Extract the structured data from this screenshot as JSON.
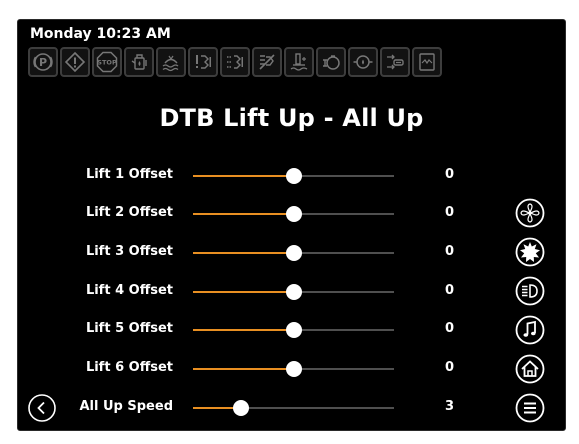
{
  "header": {
    "datetime": "Monday 10:23 AM"
  },
  "status_icons": [
    {
      "name": "parking-brake-icon"
    },
    {
      "name": "warning-icon"
    },
    {
      "name": "stop-icon"
    },
    {
      "name": "fuel-icon"
    },
    {
      "name": "washer-fluid-icon"
    },
    {
      "name": "lift-alert-icon"
    },
    {
      "name": "lift-system-icon"
    },
    {
      "name": "lift-disabled-icon"
    },
    {
      "name": "hydraulic-level-icon"
    },
    {
      "name": "engine-oil-icon"
    },
    {
      "name": "oil-pressure-icon"
    },
    {
      "name": "transmission-icon"
    },
    {
      "name": "panel-icon"
    }
  ],
  "status_icon_labels": {
    "stop": "STOP"
  },
  "page": {
    "title": "DTB Lift Up - All Up"
  },
  "settings": [
    {
      "label": "Lift 1 Offset",
      "value": "0",
      "level": 0.5
    },
    {
      "label": "Lift 2 Offset",
      "value": "0",
      "level": 0.5
    },
    {
      "label": "Lift 3 Offset",
      "value": "0",
      "level": 0.5
    },
    {
      "label": "Lift 4 Offset",
      "value": "0",
      "level": 0.5
    },
    {
      "label": "Lift 5 Offset",
      "value": "0",
      "level": 0.5
    },
    {
      "label": "Lift 6 Offset",
      "value": "0",
      "level": 0.5
    },
    {
      "label": "All Up Speed",
      "value": "3",
      "level": 0.24
    }
  ],
  "side_buttons": [
    {
      "name": "fan-button",
      "icon": "fan-icon"
    },
    {
      "name": "brightness-button",
      "icon": "sun-icon"
    },
    {
      "name": "headlight-button",
      "icon": "headlight-icon"
    },
    {
      "name": "audio-button",
      "icon": "music-note-icon"
    },
    {
      "name": "home-button",
      "icon": "home-icon"
    },
    {
      "name": "menu-button",
      "icon": "menu-icon"
    }
  ],
  "nav": {
    "back_icon": "back-arrow-icon"
  },
  "colors": {
    "background": "#000000",
    "slider_fill": "#e88f22",
    "slider_track": "#4f4f4f",
    "icon_tile": "#6e6e6e",
    "text": "#ffffff"
  }
}
